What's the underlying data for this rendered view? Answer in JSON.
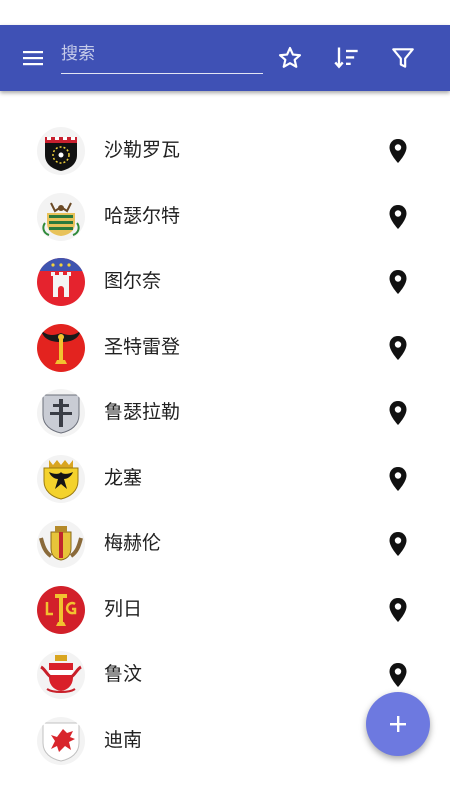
{
  "toolbar": {
    "search_placeholder": "搜索",
    "accent_color": "#3f51b5",
    "icons": [
      "menu-icon",
      "star-icon",
      "sort-icon",
      "filter-icon"
    ]
  },
  "cities": [
    {
      "name": "沙勒罗瓦",
      "crest": "charleroi-crest-icon"
    },
    {
      "name": "哈瑟尔特",
      "crest": "hasselt-crest-icon"
    },
    {
      "name": "图尔奈",
      "crest": "tournai-crest-icon"
    },
    {
      "name": "圣特雷登",
      "crest": "sint-truiden-crest-icon"
    },
    {
      "name": "鲁瑟拉勒",
      "crest": "roeselare-crest-icon"
    },
    {
      "name": "龙塞",
      "crest": "ronse-crest-icon"
    },
    {
      "name": "梅赫伦",
      "crest": "mechelen-crest-icon"
    },
    {
      "name": "列日",
      "crest": "liege-crest-icon"
    },
    {
      "name": "鲁汶",
      "crest": "leuven-crest-icon"
    },
    {
      "name": "迪南",
      "crest": "dinant-crest-icon"
    }
  ],
  "fab": {
    "icon": "plus-icon",
    "color": "#6d79e0"
  }
}
